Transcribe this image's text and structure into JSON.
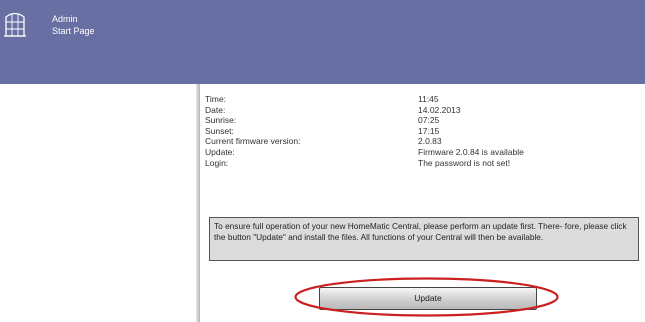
{
  "header": {
    "line1": "Admin",
    "line2": "Start Page"
  },
  "info": [
    {
      "label": "Time:",
      "value": "11:45"
    },
    {
      "label": "Date:",
      "value": "14.02.2013"
    },
    {
      "label": "Sunrise:",
      "value": "07:25"
    },
    {
      "label": "Sunset:",
      "value": "17:15"
    },
    {
      "label": "Current firmware version:",
      "value": "2.0.83"
    },
    {
      "label": "Update:",
      "value": "Firmware 2.0.84 is available"
    },
    {
      "label": "Login:",
      "value": "The password is not set!"
    }
  ],
  "notice": {
    "text": "To ensure full operation of your new HomeMatic Central, please perform an update first. There- fore, please click the button \"Update\" and install the files. All functions of your Central will then be available."
  },
  "update_button": {
    "label": "Update"
  },
  "colors": {
    "header": "#6870a3",
    "notice_bg": "#dcdcdc",
    "highlight": "#cc2020"
  }
}
